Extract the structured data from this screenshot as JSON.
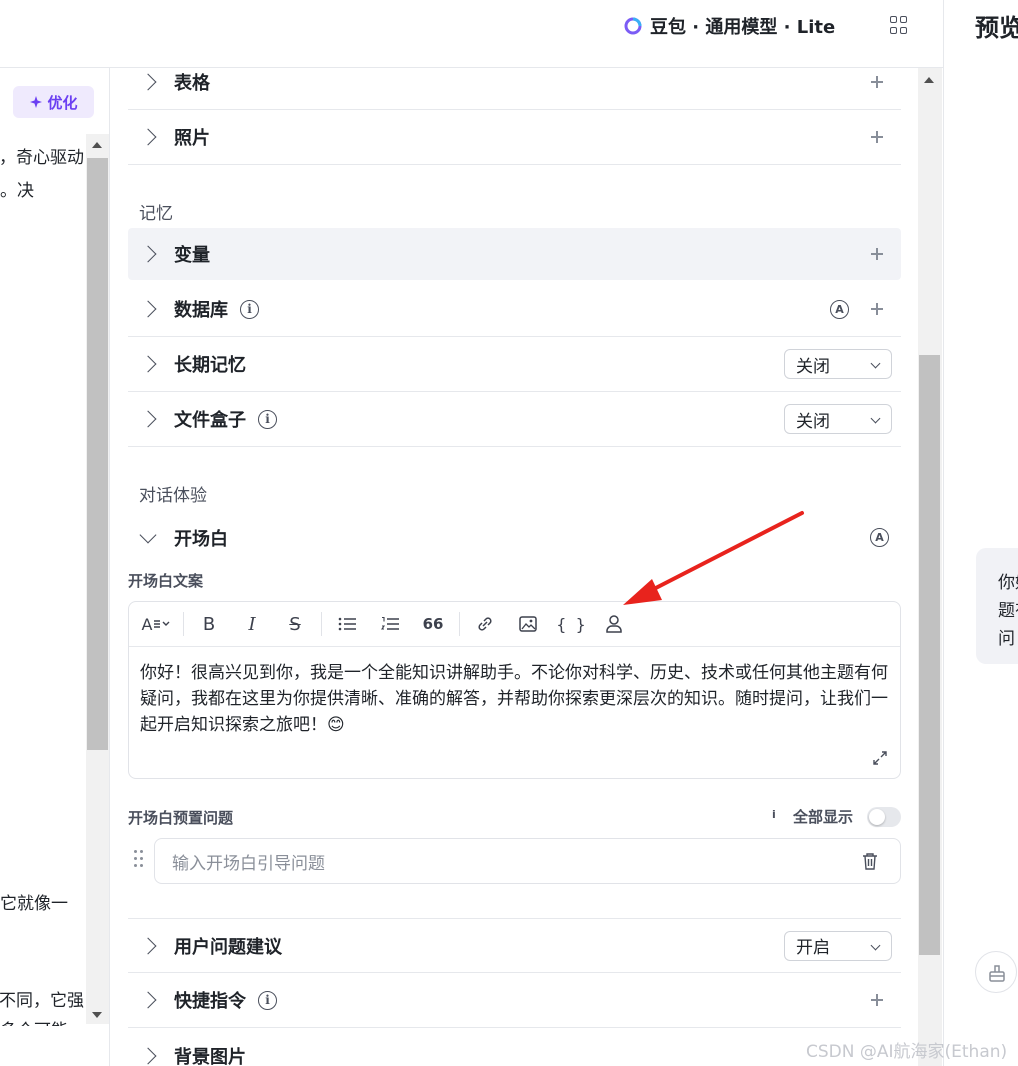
{
  "header": {
    "model_label": "豆包 · 通用模型 · Lite",
    "preview_title": "预览"
  },
  "left": {
    "optimize_label": "优化",
    "text_lines": [
      "奇心驱动，",
      "决。",
      "它就像一",
      "不同，它强",
      "多个可能"
    ]
  },
  "sections": {
    "memory": "记忆",
    "dialog": "对话体验"
  },
  "rows": {
    "table": "表格",
    "photo": "照片",
    "variable": "变量",
    "database": "数据库",
    "long_memory": "长期记忆",
    "file_box": "文件盒子",
    "opener": "开场白",
    "user_suggest": "用户问题建议",
    "shortcut": "快捷指令",
    "background": "背景图片"
  },
  "selects": {
    "long_memory": "关闭",
    "file_box": "关闭",
    "user_suggest": "开启"
  },
  "opener": {
    "copy_label": "开场白文案",
    "text": "你好！很高兴见到你，我是一个全能知识讲解助手。不论你对科学、历史、技术或任何其他主题有何疑问，我都在这里为你提供清晰、准确的解答，并帮助你探索更深层次的知识。随时提问，让我们一起开启知识探索之旅吧！😊",
    "preset_label": "开场白预置问题",
    "show_all": "全部显示",
    "show_all_enabled": false,
    "question_placeholder": "输入开场白引导问题"
  },
  "toolbar": {
    "font": "A",
    "bold": "B",
    "italic": "I",
    "strike": "S",
    "quote": "66",
    "code": "{ }"
  },
  "preview": {
    "bubble_lines": [
      "你好",
      "题有",
      "问"
    ]
  },
  "watermark": "CSDN @AI航海家(Ethan)",
  "colors": {
    "accent": "#6b3ff2",
    "annotation_arrow": "#e8231d"
  }
}
